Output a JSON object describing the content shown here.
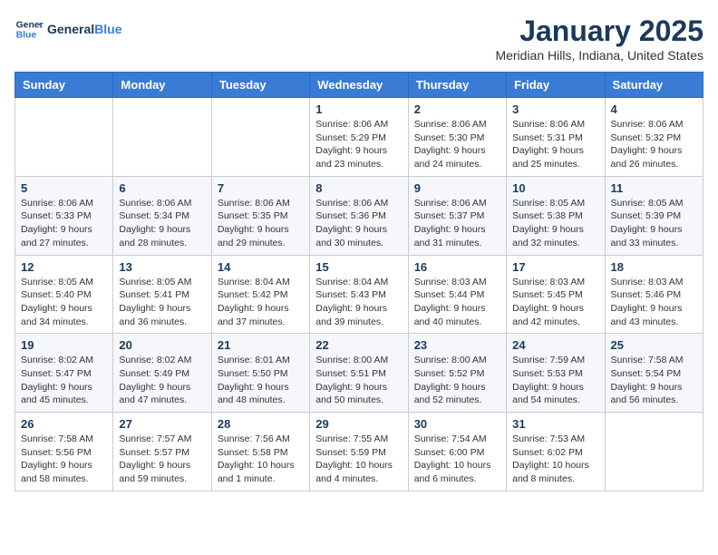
{
  "header": {
    "logo_line1": "General",
    "logo_line2": "Blue",
    "month": "January 2025",
    "location": "Meridian Hills, Indiana, United States"
  },
  "days_of_week": [
    "Sunday",
    "Monday",
    "Tuesday",
    "Wednesday",
    "Thursday",
    "Friday",
    "Saturday"
  ],
  "weeks": [
    [
      {
        "day": "",
        "info": ""
      },
      {
        "day": "",
        "info": ""
      },
      {
        "day": "",
        "info": ""
      },
      {
        "day": "1",
        "info": "Sunrise: 8:06 AM\nSunset: 5:29 PM\nDaylight: 9 hours\nand 23 minutes."
      },
      {
        "day": "2",
        "info": "Sunrise: 8:06 AM\nSunset: 5:30 PM\nDaylight: 9 hours\nand 24 minutes."
      },
      {
        "day": "3",
        "info": "Sunrise: 8:06 AM\nSunset: 5:31 PM\nDaylight: 9 hours\nand 25 minutes."
      },
      {
        "day": "4",
        "info": "Sunrise: 8:06 AM\nSunset: 5:32 PM\nDaylight: 9 hours\nand 26 minutes."
      }
    ],
    [
      {
        "day": "5",
        "info": "Sunrise: 8:06 AM\nSunset: 5:33 PM\nDaylight: 9 hours\nand 27 minutes."
      },
      {
        "day": "6",
        "info": "Sunrise: 8:06 AM\nSunset: 5:34 PM\nDaylight: 9 hours\nand 28 minutes."
      },
      {
        "day": "7",
        "info": "Sunrise: 8:06 AM\nSunset: 5:35 PM\nDaylight: 9 hours\nand 29 minutes."
      },
      {
        "day": "8",
        "info": "Sunrise: 8:06 AM\nSunset: 5:36 PM\nDaylight: 9 hours\nand 30 minutes."
      },
      {
        "day": "9",
        "info": "Sunrise: 8:06 AM\nSunset: 5:37 PM\nDaylight: 9 hours\nand 31 minutes."
      },
      {
        "day": "10",
        "info": "Sunrise: 8:05 AM\nSunset: 5:38 PM\nDaylight: 9 hours\nand 32 minutes."
      },
      {
        "day": "11",
        "info": "Sunrise: 8:05 AM\nSunset: 5:39 PM\nDaylight: 9 hours\nand 33 minutes."
      }
    ],
    [
      {
        "day": "12",
        "info": "Sunrise: 8:05 AM\nSunset: 5:40 PM\nDaylight: 9 hours\nand 34 minutes."
      },
      {
        "day": "13",
        "info": "Sunrise: 8:05 AM\nSunset: 5:41 PM\nDaylight: 9 hours\nand 36 minutes."
      },
      {
        "day": "14",
        "info": "Sunrise: 8:04 AM\nSunset: 5:42 PM\nDaylight: 9 hours\nand 37 minutes."
      },
      {
        "day": "15",
        "info": "Sunrise: 8:04 AM\nSunset: 5:43 PM\nDaylight: 9 hours\nand 39 minutes."
      },
      {
        "day": "16",
        "info": "Sunrise: 8:03 AM\nSunset: 5:44 PM\nDaylight: 9 hours\nand 40 minutes."
      },
      {
        "day": "17",
        "info": "Sunrise: 8:03 AM\nSunset: 5:45 PM\nDaylight: 9 hours\nand 42 minutes."
      },
      {
        "day": "18",
        "info": "Sunrise: 8:03 AM\nSunset: 5:46 PM\nDaylight: 9 hours\nand 43 minutes."
      }
    ],
    [
      {
        "day": "19",
        "info": "Sunrise: 8:02 AM\nSunset: 5:47 PM\nDaylight: 9 hours\nand 45 minutes."
      },
      {
        "day": "20",
        "info": "Sunrise: 8:02 AM\nSunset: 5:49 PM\nDaylight: 9 hours\nand 47 minutes."
      },
      {
        "day": "21",
        "info": "Sunrise: 8:01 AM\nSunset: 5:50 PM\nDaylight: 9 hours\nand 48 minutes."
      },
      {
        "day": "22",
        "info": "Sunrise: 8:00 AM\nSunset: 5:51 PM\nDaylight: 9 hours\nand 50 minutes."
      },
      {
        "day": "23",
        "info": "Sunrise: 8:00 AM\nSunset: 5:52 PM\nDaylight: 9 hours\nand 52 minutes."
      },
      {
        "day": "24",
        "info": "Sunrise: 7:59 AM\nSunset: 5:53 PM\nDaylight: 9 hours\nand 54 minutes."
      },
      {
        "day": "25",
        "info": "Sunrise: 7:58 AM\nSunset: 5:54 PM\nDaylight: 9 hours\nand 56 minutes."
      }
    ],
    [
      {
        "day": "26",
        "info": "Sunrise: 7:58 AM\nSunset: 5:56 PM\nDaylight: 9 hours\nand 58 minutes."
      },
      {
        "day": "27",
        "info": "Sunrise: 7:57 AM\nSunset: 5:57 PM\nDaylight: 9 hours\nand 59 minutes."
      },
      {
        "day": "28",
        "info": "Sunrise: 7:56 AM\nSunset: 5:58 PM\nDaylight: 10 hours\nand 1 minute."
      },
      {
        "day": "29",
        "info": "Sunrise: 7:55 AM\nSunset: 5:59 PM\nDaylight: 10 hours\nand 4 minutes."
      },
      {
        "day": "30",
        "info": "Sunrise: 7:54 AM\nSunset: 6:00 PM\nDaylight: 10 hours\nand 6 minutes."
      },
      {
        "day": "31",
        "info": "Sunrise: 7:53 AM\nSunset: 6:02 PM\nDaylight: 10 hours\nand 8 minutes."
      },
      {
        "day": "",
        "info": ""
      }
    ]
  ]
}
